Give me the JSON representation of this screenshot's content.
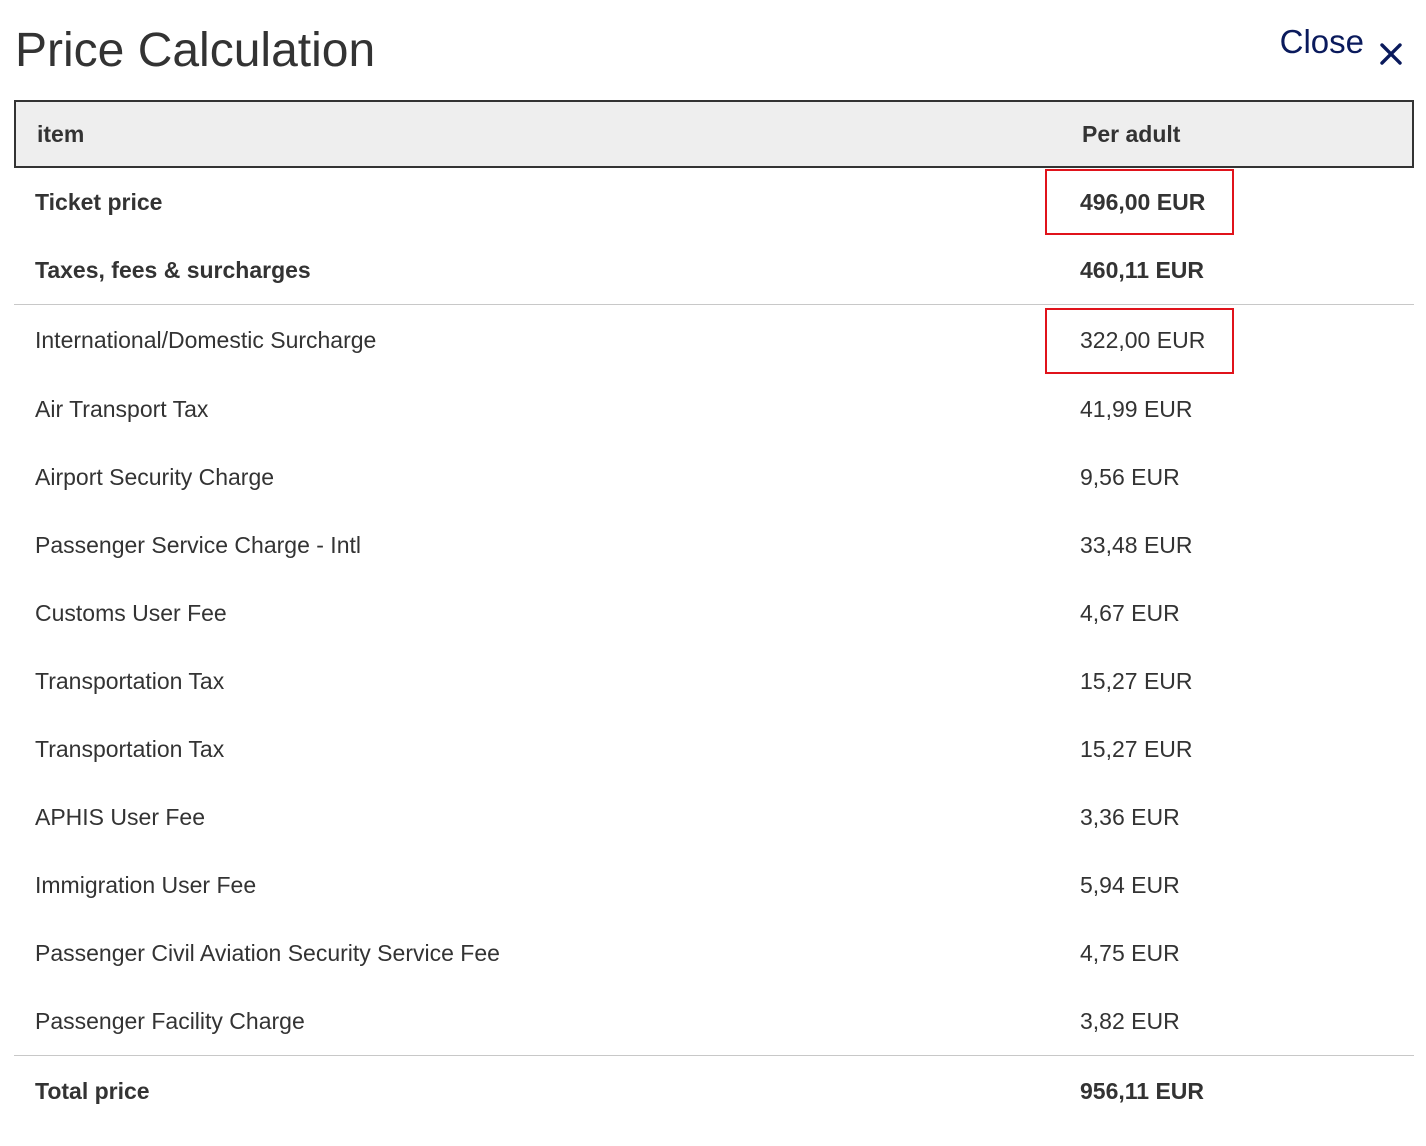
{
  "dialog": {
    "title": "Price Calculation",
    "close_label": "Close",
    "close_icon": "close-icon"
  },
  "table": {
    "headers": {
      "item": "item",
      "per_adult": "Per adult"
    },
    "ticket": {
      "label": "Ticket price",
      "value": "496,00 EUR",
      "highlighted": true
    },
    "taxes": {
      "label": "Taxes, fees & surcharges",
      "value": "460,11 EUR"
    },
    "breakdown": [
      {
        "label": "International/Domestic Surcharge",
        "value": "322,00 EUR",
        "highlighted": true
      },
      {
        "label": "Air Transport Tax",
        "value": "41,99 EUR"
      },
      {
        "label": "Airport Security Charge",
        "value": "9,56 EUR"
      },
      {
        "label": "Passenger Service Charge - Intl",
        "value": "33,48 EUR"
      },
      {
        "label": "Customs User Fee",
        "value": "4,67 EUR"
      },
      {
        "label": "Transportation Tax",
        "value": "15,27 EUR"
      },
      {
        "label": "Transportation Tax",
        "value": "15,27 EUR"
      },
      {
        "label": "APHIS User Fee",
        "value": "3,36 EUR"
      },
      {
        "label": "Immigration User Fee",
        "value": "5,94 EUR"
      },
      {
        "label": "Passenger Civil Aviation Security Service Fee",
        "value": "4,75 EUR"
      },
      {
        "label": "Passenger Facility Charge",
        "value": "3,82 EUR"
      }
    ],
    "total": {
      "label": "Total price",
      "value": "956,11 EUR"
    }
  },
  "colors": {
    "highlight": "#e0131b",
    "close_link": "#0a1a5c",
    "header_bg": "#eeeeee"
  }
}
